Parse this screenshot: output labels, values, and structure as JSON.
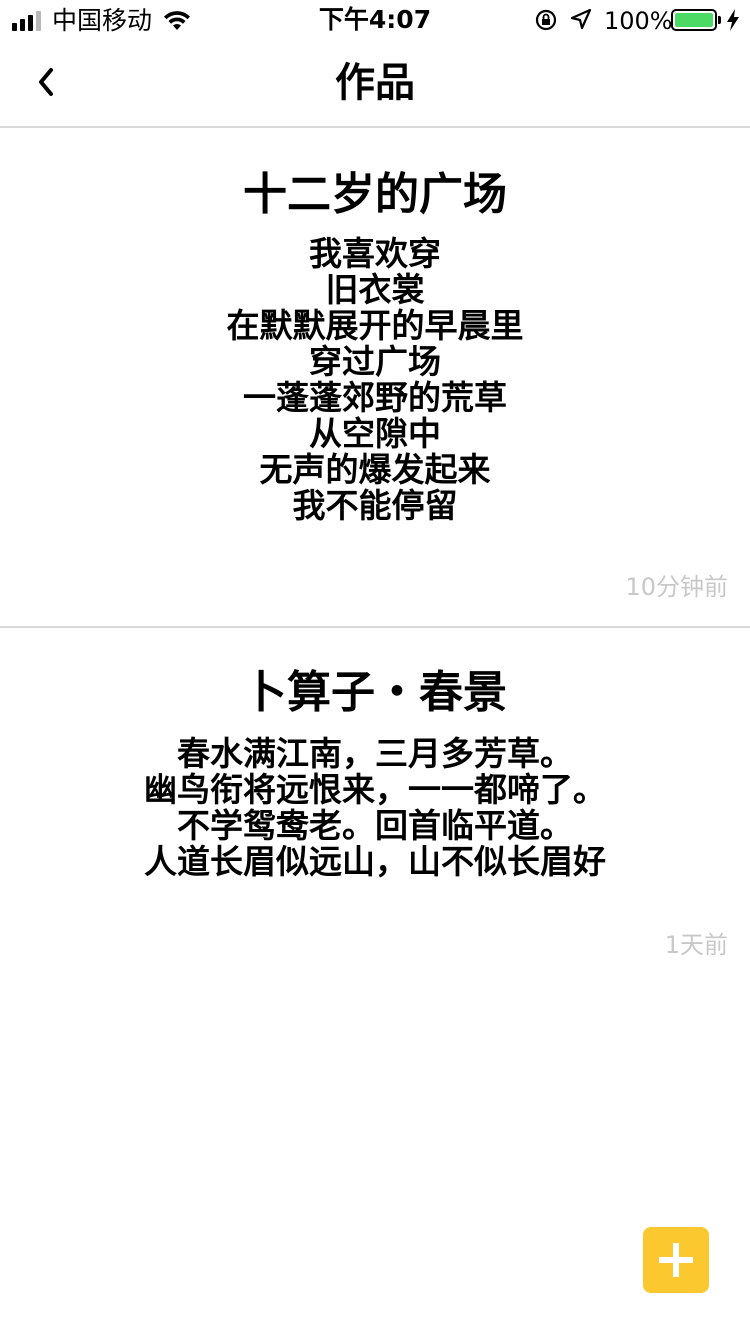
{
  "status_bar": {
    "carrier": "中国移动",
    "time": "下午4:07",
    "battery_percent": "100%",
    "battery_level": 1.0,
    "battery_color": "#4cd964",
    "icons": [
      "signal-icon",
      "wifi-icon",
      "orientation-lock-icon",
      "location-icon",
      "battery-icon",
      "charging-icon"
    ]
  },
  "nav": {
    "title": "作品",
    "back_icon": "chevron-left-icon"
  },
  "poems": [
    {
      "title": "十二岁的广场",
      "lines": [
        "我喜欢穿",
        "旧衣裳",
        "在默默展开的早晨里",
        "穿过广场",
        "一蓬蓬郊野的荒草",
        "从空隙中",
        "无声的爆发起来",
        "我不能停留"
      ],
      "time": "10分钟前"
    },
    {
      "title": "卜算子・春景",
      "lines": [
        "春水满江南，三月多芳草。",
        "幽鸟衔将远恨来，一一都啼了。",
        "不学鸳鸯老。回首临平道。",
        "人道长眉似远山，山不似长眉好"
      ],
      "time": "1天前"
    }
  ],
  "add_button": {
    "icon": "plus-icon",
    "color": "#fbc82f"
  }
}
